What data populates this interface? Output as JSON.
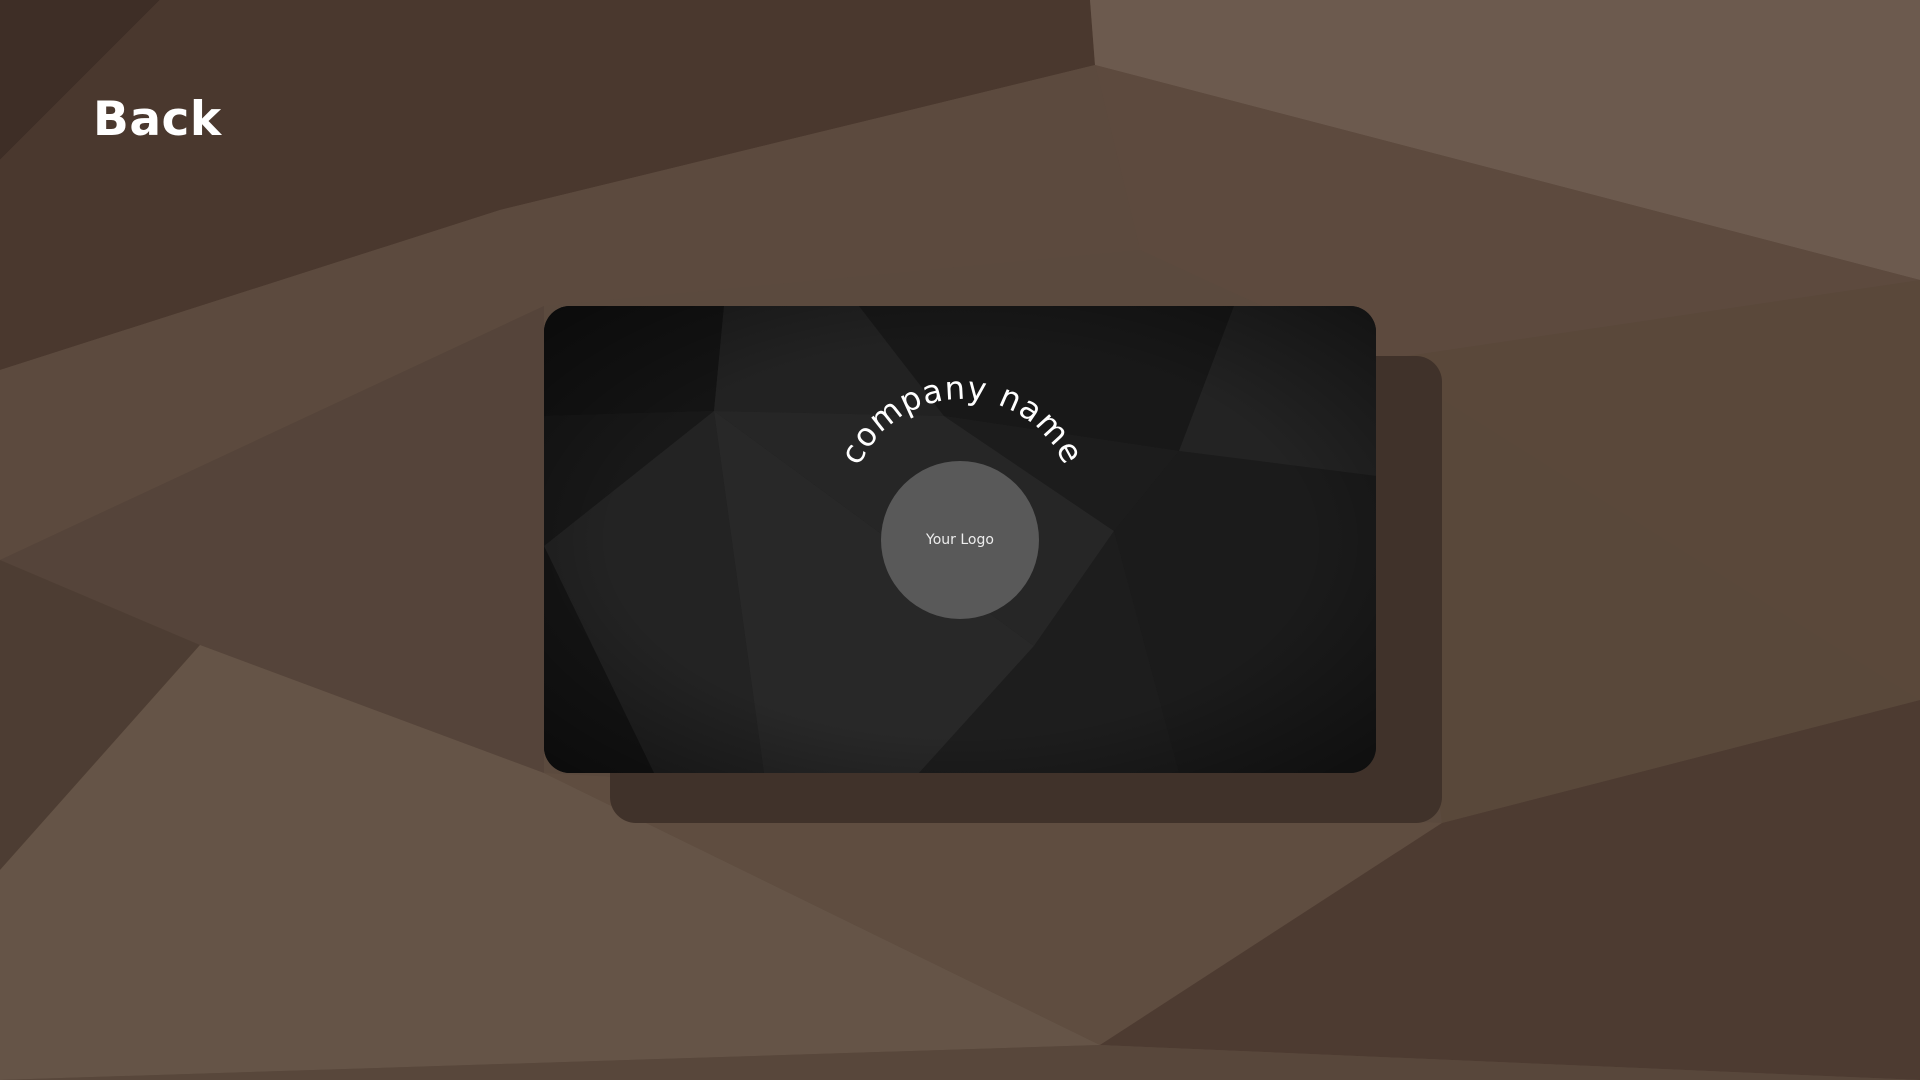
{
  "page": {
    "heading": "Back"
  },
  "card": {
    "company_name": "company name",
    "logo_placeholder": "Your Logo"
  },
  "colors": {
    "background": "#5a4a3f",
    "card": "#1e1e1e",
    "card_shadow": "#40322a",
    "logo_circle": "#595959",
    "text": "#ffffff"
  }
}
